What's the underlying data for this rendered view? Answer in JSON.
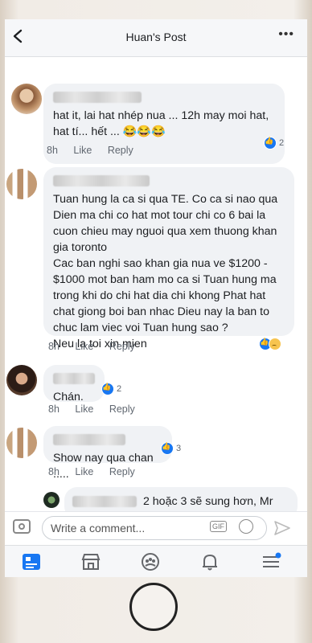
{
  "header": {
    "title": "Huan's Post"
  },
  "comments": [
    {
      "text": "hat it, lai hat nhép nua ... 12h may moi hat,\nhat tí... hết ... 😂😂😂",
      "time": "8h",
      "like": "Like",
      "reply": "Reply",
      "reactions": "2"
    },
    {
      "text": "Tuan hung la ca si qua TE. Co ca si nao qua Dien ma chi co hat mot tour chi co 6 bai la cuon chieu may nguoi qua xem thuong khan gia toronto\nCac ban nghi sao khan gia nua ve $1200 - $1000 mot ban ham mo ca si Tuan hung ma trong khi do chi hat  dia chi khong Phat hat chat giong boi ban nhac Dieu nay la ban to chuc lam viec voi Tuan hung sao ?\nNeu la toi xin mien",
      "time": "8h",
      "like": "Like",
      "reply": "Reply",
      "reactions": ""
    },
    {
      "text": "Chán.",
      "time": "8h",
      "like": "Like",
      "reply": "Reply",
      "reactions": "2"
    },
    {
      "text": "Show nay qua chan .....",
      "time": "8h",
      "like": "Like",
      "reply": "Reply",
      "reactions": "3"
    },
    {
      "text": "2 hoặc 3 sẽ sung hơn, Mr"
    }
  ],
  "composer": {
    "placeholder": "Write a comment...",
    "gif_label": "GIF"
  },
  "tabs": [
    "news-feed-icon",
    "marketplace-icon",
    "groups-icon",
    "notifications-icon",
    "menu-icon"
  ],
  "colors": {
    "accent": "#1877f2",
    "bubble": "#f0f2f5",
    "meta": "#606770"
  }
}
